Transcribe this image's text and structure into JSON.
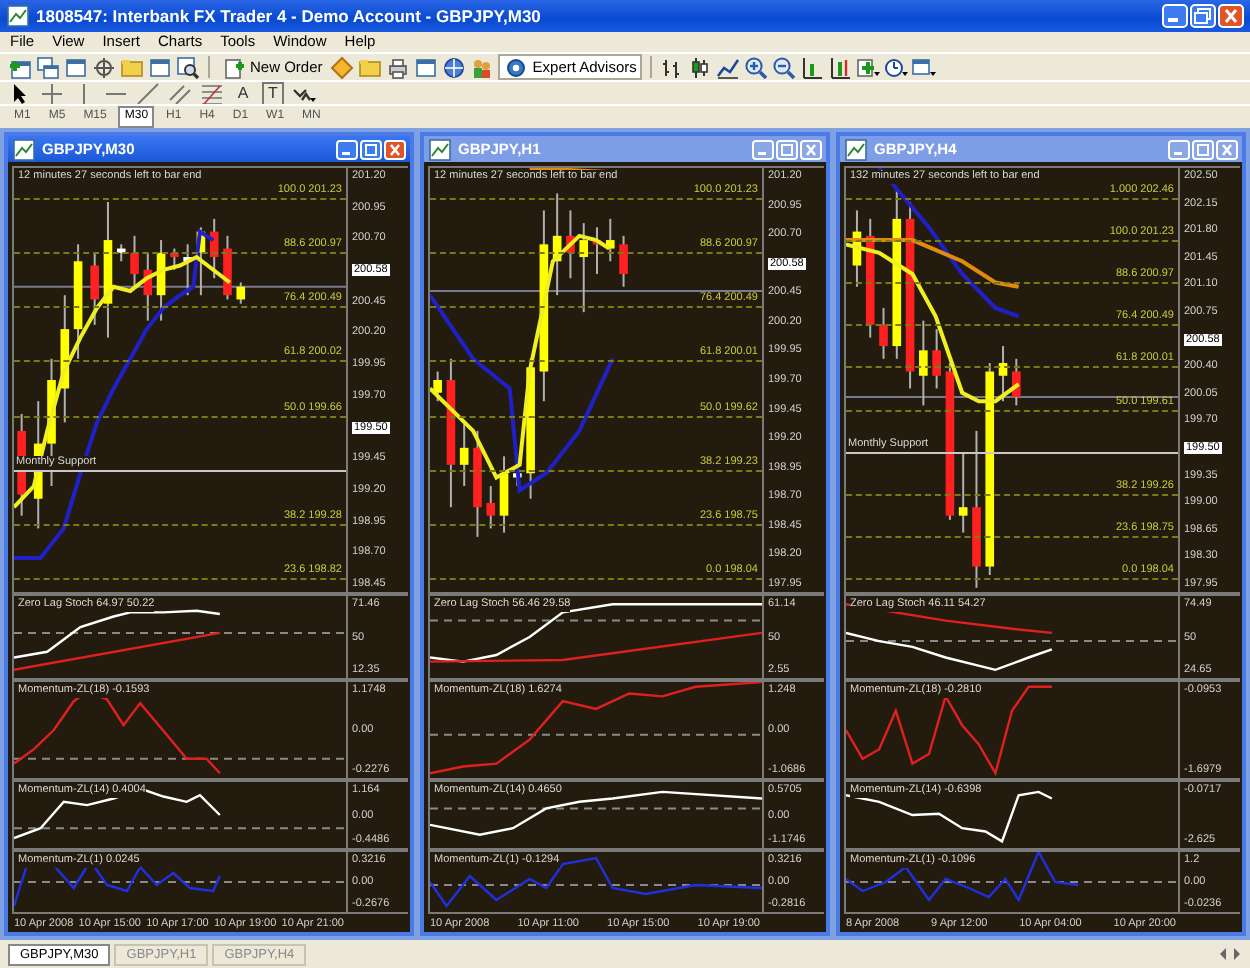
{
  "window": {
    "title": "1808547: Interbank FX Trader 4 - Demo Account - GBPJPY,M30"
  },
  "menu": [
    "File",
    "View",
    "Insert",
    "Charts",
    "Tools",
    "Window",
    "Help"
  ],
  "toolbar": {
    "new_order": "New Order",
    "expert_advisors": "Expert Advisors"
  },
  "drawing_tools": {
    "text_tool": "A",
    "label_tool": "T"
  },
  "timeframes": [
    {
      "label": "M1",
      "selected": false
    },
    {
      "label": "M5",
      "selected": false
    },
    {
      "label": "M15",
      "selected": false
    },
    {
      "label": "M30",
      "selected": true
    },
    {
      "label": "H1",
      "selected": false
    },
    {
      "label": "H4",
      "selected": false
    },
    {
      "label": "D1",
      "selected": false
    },
    {
      "label": "W1",
      "selected": false
    },
    {
      "label": "MN",
      "selected": false
    }
  ],
  "charts": [
    {
      "title": "GBPJPY,M30",
      "active": true,
      "info": "12 minutes 27 seconds left to bar end",
      "price_axis": [
        {
          "label": "201.20",
          "kind": "tick"
        },
        {
          "label": "200.95",
          "kind": "tick"
        },
        {
          "label": "200.70",
          "kind": "tick"
        },
        {
          "label": "200.58",
          "kind": "marker"
        },
        {
          "label": "200.45",
          "kind": "tick"
        },
        {
          "label": "200.20",
          "kind": "tick"
        },
        {
          "label": "199.95",
          "kind": "tick"
        },
        {
          "label": "199.70",
          "kind": "tick"
        },
        {
          "label": "199.50",
          "kind": "marker"
        },
        {
          "label": "199.45",
          "kind": "tick"
        },
        {
          "label": "199.20",
          "kind": "tick"
        },
        {
          "label": "198.95",
          "kind": "tick"
        },
        {
          "label": "198.70",
          "kind": "tick"
        },
        {
          "label": "198.45",
          "kind": "tick"
        }
      ],
      "levels": [
        {
          "label": "100.0 201.23",
          "kind": "fib"
        },
        {
          "label": "88.6 200.97",
          "kind": "fib"
        },
        {
          "label": "76.4 200.49",
          "kind": "fib"
        },
        {
          "label": "61.8 200.02",
          "kind": "fib"
        },
        {
          "label": "50.0 199.66",
          "kind": "fib"
        },
        {
          "label": "Monthly Support",
          "kind": "support"
        },
        {
          "label": "38.2 199.28",
          "kind": "fib"
        },
        {
          "label": "23.6 198.82",
          "kind": "fib"
        }
      ],
      "indicators": [
        {
          "title": "Zero Lag Stoch 64.97 50.22",
          "axis": [
            "71.46",
            "50",
            "12.35"
          ]
        },
        {
          "title": "Momentum-ZL(18) -0.1593",
          "axis": [
            "1.1748",
            "0.00",
            "-0.2276"
          ]
        },
        {
          "title": "Momentum-ZL(14) 0.4004",
          "axis": [
            "1.164",
            "0.00",
            "-0.4486"
          ]
        },
        {
          "title": "Momentum-ZL(1) 0.0245",
          "axis": [
            "0.3216",
            "0.00",
            "-0.2676"
          ]
        }
      ],
      "time_axis": [
        "10 Apr 2008",
        "10 Apr 15:00",
        "10 Apr 17:00",
        "10 Apr 19:00",
        "10 Apr 21:00"
      ]
    },
    {
      "title": "GBPJPY,H1",
      "active": false,
      "info": "12 minutes 27 seconds left to bar end",
      "price_axis": [
        {
          "label": "201.20",
          "kind": "tick"
        },
        {
          "label": "200.95",
          "kind": "tick"
        },
        {
          "label": "200.70",
          "kind": "tick"
        },
        {
          "label": "200.58",
          "kind": "marker"
        },
        {
          "label": "200.45",
          "kind": "tick"
        },
        {
          "label": "200.20",
          "kind": "tick"
        },
        {
          "label": "199.95",
          "kind": "tick"
        },
        {
          "label": "199.70",
          "kind": "tick"
        },
        {
          "label": "199.45",
          "kind": "tick"
        },
        {
          "label": "199.20",
          "kind": "tick"
        },
        {
          "label": "198.95",
          "kind": "tick"
        },
        {
          "label": "198.70",
          "kind": "tick"
        },
        {
          "label": "198.45",
          "kind": "tick"
        },
        {
          "label": "198.20",
          "kind": "tick"
        },
        {
          "label": "197.95",
          "kind": "tick"
        }
      ],
      "levels": [
        {
          "label": "100.0 201.23",
          "kind": "fib"
        },
        {
          "label": "88.6 200.97",
          "kind": "fib"
        },
        {
          "label": "76.4 200.49",
          "kind": "fib"
        },
        {
          "label": "61.8 200.01",
          "kind": "fib"
        },
        {
          "label": "50.0 199.62",
          "kind": "fib"
        },
        {
          "label": "38.2 199.23",
          "kind": "fib"
        },
        {
          "label": "23.6 198.75",
          "kind": "fib"
        },
        {
          "label": "0.0 198.04",
          "kind": "fib"
        }
      ],
      "indicators": [
        {
          "title": "Zero Lag Stoch 56.46 29.58",
          "axis": [
            "61.14",
            "50",
            "2.55"
          ]
        },
        {
          "title": "Momentum-ZL(18) 1.6274",
          "axis": [
            "1.248",
            "0.00",
            "-1.0686"
          ]
        },
        {
          "title": "Momentum-ZL(14) 0.4650",
          "axis": [
            "0.5705",
            "0.00",
            "-1.1746"
          ]
        },
        {
          "title": "Momentum-ZL(1) -0.1294",
          "axis": [
            "0.3216",
            "0.00",
            "-0.2816"
          ]
        }
      ],
      "time_axis": [
        "10 Apr 2008",
        "10 Apr 11:00",
        "10 Apr 15:00",
        "10 Apr 19:00"
      ]
    },
    {
      "title": "GBPJPY,H4",
      "active": false,
      "info": "132 minutes 27 seconds left to bar end",
      "price_axis": [
        {
          "label": "202.50",
          "kind": "tick"
        },
        {
          "label": "202.15",
          "kind": "tick"
        },
        {
          "label": "201.80",
          "kind": "tick"
        },
        {
          "label": "201.45",
          "kind": "tick"
        },
        {
          "label": "201.10",
          "kind": "tick"
        },
        {
          "label": "200.75",
          "kind": "tick"
        },
        {
          "label": "200.58",
          "kind": "marker"
        },
        {
          "label": "200.40",
          "kind": "tick"
        },
        {
          "label": "200.05",
          "kind": "tick"
        },
        {
          "label": "199.70",
          "kind": "tick"
        },
        {
          "label": "199.50",
          "kind": "marker"
        },
        {
          "label": "199.35",
          "kind": "tick"
        },
        {
          "label": "199.00",
          "kind": "tick"
        },
        {
          "label": "198.65",
          "kind": "tick"
        },
        {
          "label": "198.30",
          "kind": "tick"
        },
        {
          "label": "197.95",
          "kind": "tick"
        }
      ],
      "levels": [
        {
          "label": "1.000 202.46",
          "kind": "fib"
        },
        {
          "label": "100.0 201.23",
          "kind": "fib"
        },
        {
          "label": "88.6 200.97",
          "kind": "fib"
        },
        {
          "label": "76.4 200.49",
          "kind": "fib"
        },
        {
          "label": "61.8 200.01",
          "kind": "fib"
        },
        {
          "label": "50.0 199.61",
          "kind": "fib"
        },
        {
          "label": "Monthly Support",
          "kind": "support"
        },
        {
          "label": "38.2 199.26",
          "kind": "fib"
        },
        {
          "label": "23.6 198.75",
          "kind": "fib"
        },
        {
          "label": "0.0 198.04",
          "kind": "fib"
        }
      ],
      "indicators": [
        {
          "title": "Zero Lag Stoch 46.11 54.27",
          "axis": [
            "74.49",
            "50",
            "24.65"
          ]
        },
        {
          "title": "Momentum-ZL(18) -0.2810",
          "axis": [
            "-0.0953",
            "-1.6979"
          ]
        },
        {
          "title": "Momentum-ZL(14) -0.6398",
          "axis": [
            "-0.0717",
            "-2.625"
          ]
        },
        {
          "title": "Momentum-ZL(1) -0.1096",
          "axis": [
            "1.2",
            "0.00",
            "-0.0236"
          ]
        }
      ],
      "time_axis": [
        "8 Apr 2008",
        "9 Apr 12:00",
        "10 Apr 04:00",
        "10 Apr 20:00"
      ]
    }
  ],
  "tabs": [
    {
      "label": "GBPJPY,M30",
      "selected": true
    },
    {
      "label": "GBPJPY,H1",
      "selected": false
    },
    {
      "label": "GBPJPY,H4",
      "selected": false
    }
  ]
}
